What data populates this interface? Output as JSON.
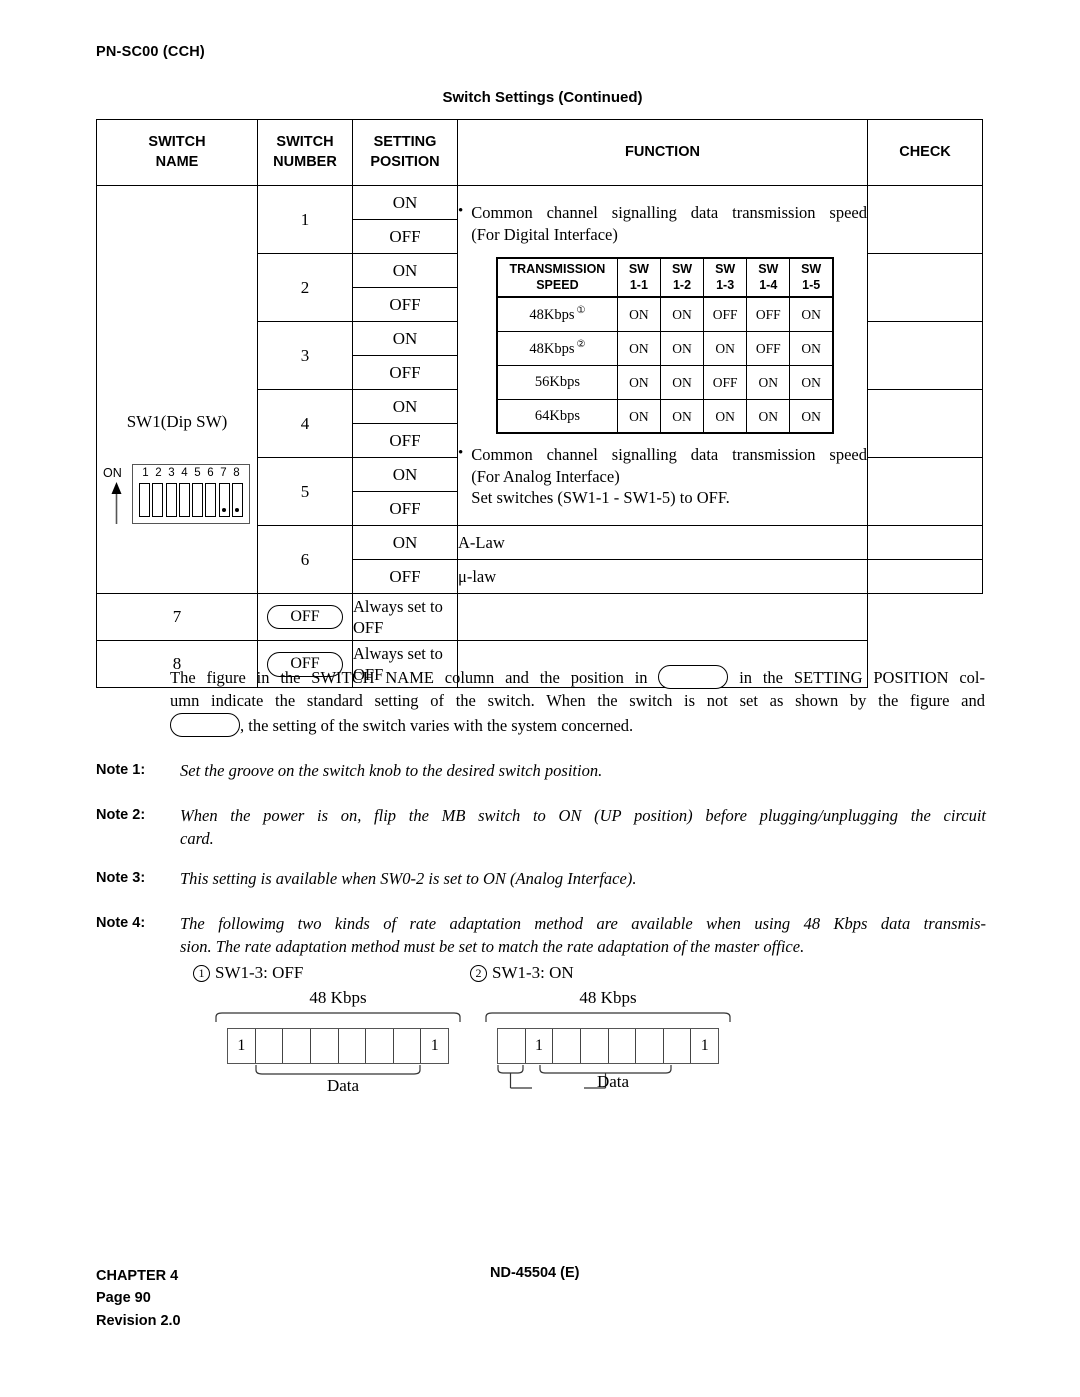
{
  "header": {
    "code": "PN-SC00 (CCH)",
    "title": "Switch Settings  (Continued)"
  },
  "table": {
    "columns": {
      "name_l1": "SWITCH",
      "name_l2": "NAME",
      "number_l1": "SWITCH",
      "number_l2": "NUMBER",
      "position_l1": "SETTING",
      "position_l2": "POSITION",
      "function": "FUNCTION",
      "check": "CHECK"
    },
    "switch_name": {
      "label": "SW1(Dip SW)",
      "on_label": "ON",
      "dip_numbers": [
        "1",
        "2",
        "3",
        "4",
        "5",
        "6",
        "7",
        "8"
      ],
      "dip_dotted": [
        false,
        false,
        false,
        false,
        false,
        false,
        true,
        true
      ]
    },
    "rows": [
      {
        "number": "1",
        "on": "ON",
        "off": "OFF"
      },
      {
        "number": "2",
        "on": "ON",
        "off": "OFF"
      },
      {
        "number": "3",
        "on": "ON",
        "off": "OFF"
      },
      {
        "number": "4",
        "on": "ON",
        "off": "OFF"
      },
      {
        "number": "5",
        "on": "ON",
        "off": "OFF"
      },
      {
        "number": "6",
        "on": "ON",
        "off": "OFF"
      },
      {
        "number": "7",
        "position": "OFF"
      },
      {
        "number": "8",
        "position": "OFF"
      }
    ],
    "function": {
      "bullet1_l1": "Common channel signalling data transmission speed",
      "bullet1_l2": "(For Digital Interface)",
      "bullet2_l1": "Common channel signalling data transmission speed",
      "bullet2_l2": "(For Analog Interface)",
      "bullet2_l3": "Set switches (SW1-1 - SW1-5) to OFF.",
      "row6_on": "A-Law",
      "row6_off": "μ-law",
      "row7": "Always set to OFF",
      "row8": "Always set to OFF"
    }
  },
  "transmission_table": {
    "headers": [
      {
        "l1": "TRANSMISSION",
        "l2": "SPEED"
      },
      {
        "l1": "SW",
        "l2": "1-1"
      },
      {
        "l1": "SW",
        "l2": "1-2"
      },
      {
        "l1": "SW",
        "l2": "1-3"
      },
      {
        "l1": "SW",
        "l2": "1-4"
      },
      {
        "l1": "SW",
        "l2": "1-5"
      }
    ],
    "rows": [
      {
        "speed": "48Kbps",
        "note": "①",
        "sw": [
          "ON",
          "ON",
          "OFF",
          "OFF",
          "ON"
        ]
      },
      {
        "speed": "48Kbps",
        "note": "②",
        "sw": [
          "ON",
          "ON",
          "ON",
          "OFF",
          "ON"
        ]
      },
      {
        "speed": "56Kbps",
        "note": "",
        "sw": [
          "ON",
          "ON",
          "OFF",
          "ON",
          "ON"
        ]
      },
      {
        "speed": "64Kbps",
        "note": "",
        "sw": [
          "ON",
          "ON",
          "ON",
          "ON",
          "ON"
        ]
      }
    ]
  },
  "legend": {
    "line1_a": "The figure in the SWITCH NAME column and the position in",
    "line1_b": "in the SETTING POSITION col-",
    "line2": "umn indicate the standard setting of the switch. When the switch is not set as shown by the figure and",
    "line3": ", the setting of the switch varies with the system concerned."
  },
  "notes": [
    {
      "label": "Note 1:",
      "lines": [
        "Set the groove on the switch knob to the desired switch position."
      ]
    },
    {
      "label": "Note 2:",
      "lines": [
        "When the power is on, flip the MB switch to ON (UP position) before plugging/unplugging the circuit",
        "card."
      ]
    },
    {
      "label": "Note 3:",
      "lines": [
        "This setting is available when SW0-2 is set to ON (Analog Interface)."
      ]
    },
    {
      "label": "Note 4:",
      "lines": [
        "The followimg two kinds of rate adaptation method are available when using 48 Kbps data transmis-",
        "sion. The rate adaptation method must be set to match the rate adaptation of the master office."
      ]
    }
  ],
  "note4_items": [
    {
      "marker": "1",
      "text": "SW1-3: OFF"
    },
    {
      "marker": "2",
      "text": "SW1-3: ON"
    }
  ],
  "frame_diagrams": [
    {
      "title": "48 Kbps",
      "cells": [
        "1",
        "",
        "",
        "",
        "",
        "",
        "",
        "1"
      ],
      "label": "Data"
    },
    {
      "title": "48 Kbps",
      "cells": [
        "",
        "1",
        "",
        "",
        "",
        "",
        "",
        "1"
      ],
      "label": "Data"
    }
  ],
  "footer": {
    "chapter": "CHAPTER 4",
    "page": "Page 90",
    "revision": "Revision 2.0",
    "document": "ND-45504 (E)"
  }
}
